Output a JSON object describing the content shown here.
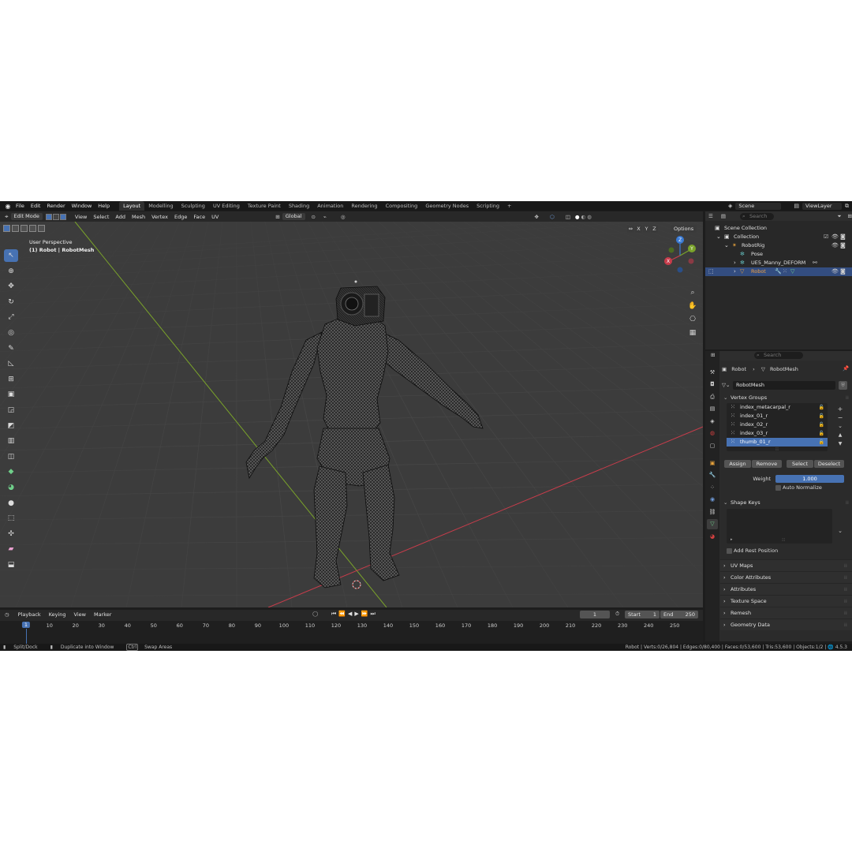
{
  "menubar": {
    "items": [
      "File",
      "Edit",
      "Render",
      "Window",
      "Help"
    ],
    "workspaces": [
      "Layout",
      "Modelling",
      "Sculpting",
      "UV Editing",
      "Texture Paint",
      "Shading",
      "Animation",
      "Rendering",
      "Compositing",
      "Geometry Nodes",
      "Scripting"
    ],
    "add_workspace": "+",
    "scene": "Scene",
    "view_layer": "ViewLayer"
  },
  "viewport": {
    "mode": "Edit Mode",
    "menus": [
      "View",
      "Select",
      "Add",
      "Mesh",
      "Vertex",
      "Edge",
      "Face",
      "UV"
    ],
    "transform_orientation": "Global",
    "perspective": "User Perspective",
    "object_info": "(1) Robot | RobotMesh",
    "axes": [
      "X",
      "Y",
      "Z"
    ],
    "options": "Options"
  },
  "outliner": {
    "search_placeholder": "Search",
    "rows": [
      "Scene Collection",
      "Collection",
      "RobotRig",
      "Pose",
      "UE5_Manny_DEFORM",
      "Robot"
    ]
  },
  "properties": {
    "search_placeholder": "Search",
    "breadcrumb_object": "Robot",
    "breadcrumb_data": "RobotMesh",
    "mesh_name": "RobotMesh",
    "vertex_groups_title": "Vertex Groups",
    "vertex_groups": [
      "index_metacarpal_r",
      "index_01_r",
      "index_02_r",
      "index_03_r",
      "thumb_01_r"
    ],
    "selected_group": "thumb_01_r",
    "assign": "Assign",
    "remove": "Remove",
    "select": "Select",
    "deselect": "Deselect",
    "weight_label": "Weight",
    "weight_value": "1.000",
    "auto_normalize": "Auto Normalize",
    "shape_keys_title": "Shape Keys",
    "add_rest_position": "Add Rest Position",
    "collapsed_panels": [
      "UV Maps",
      "Color Attributes",
      "Attributes",
      "Texture Space",
      "Remesh",
      "Geometry Data"
    ]
  },
  "timeline": {
    "menus": [
      "Playback",
      "Keying",
      "View",
      "Marker"
    ],
    "current_frame": "1",
    "start_label": "Start",
    "start_value": "1",
    "end_label": "End",
    "end_value": "250",
    "ticks": [
      "10",
      "20",
      "30",
      "40",
      "50",
      "60",
      "70",
      "80",
      "90",
      "100",
      "110",
      "120",
      "130",
      "140",
      "150",
      "160",
      "170",
      "180",
      "190",
      "200",
      "210",
      "220",
      "230",
      "240",
      "250"
    ]
  },
  "statusbar": {
    "hint1": "Split/Dock",
    "hint2": "Duplicate into Window",
    "hint3_key": "Ctrl",
    "hint3": "Swap Areas",
    "stats": "Robot | Verts:0/26,804 | Edges:0/80,400 | Faces:0/53,600 | Tris:53,600 | Objects:1/2 | ",
    "version": "4.5.3"
  },
  "colors": {
    "accent": "#4772b3",
    "selected_row": "#334d80",
    "viewport_bg": "#3c3c3c",
    "x_axis": "#c83c4b",
    "y_axis": "#7aa32a",
    "z_axis": "#3a7ad4"
  }
}
